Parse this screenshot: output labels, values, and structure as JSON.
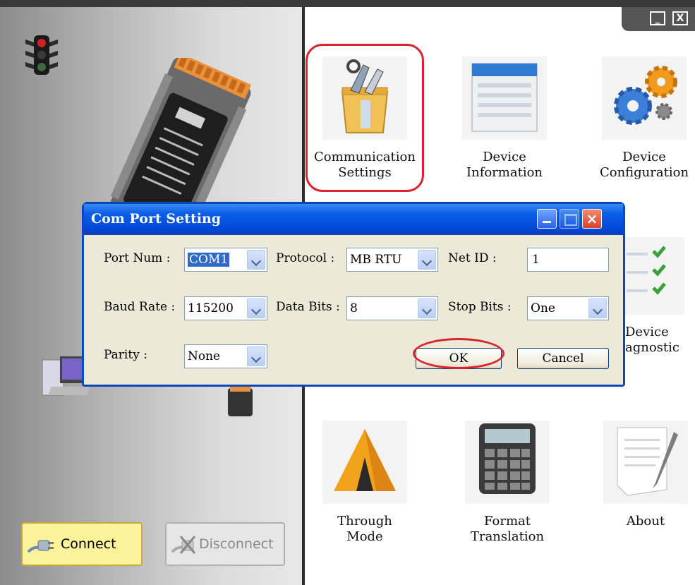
{
  "window": {
    "minimize_glyph": "_",
    "close_glyph": "X"
  },
  "left": {
    "connect_label": "Connect",
    "disconnect_label": "Disconnect"
  },
  "tiles": [
    {
      "label1": "Communication",
      "label2": "Settings",
      "icon": "toolbox-icon"
    },
    {
      "label1": "Device",
      "label2": "Information",
      "icon": "document-window-icon"
    },
    {
      "label1": "Device",
      "label2": "Configuration",
      "icon": "gears-icon"
    },
    {
      "label1": "Device",
      "label2": "Diagnostic",
      "icon": "checklist-icon"
    },
    {
      "label1": "Through",
      "label2": "Mode",
      "icon": "tent-icon"
    },
    {
      "label1": "Format",
      "label2": "Translation",
      "icon": "calculator-icon"
    },
    {
      "label1": "About",
      "label2": "",
      "icon": "notepad-icon"
    }
  ],
  "diag_visible": {
    "label1": "Device",
    "label2": "agnostic"
  },
  "dialog": {
    "title": "Com Port Setting",
    "close_glyph": "×",
    "fields": {
      "port_num": {
        "label": "Port Num :",
        "value": "COM1"
      },
      "protocol": {
        "label": "Protocol :",
        "value": "MB RTU"
      },
      "net_id": {
        "label": "Net ID :",
        "value": "1"
      },
      "baud_rate": {
        "label": "Baud Rate :",
        "value": "115200"
      },
      "data_bits": {
        "label": "Data Bits :",
        "value": "8"
      },
      "stop_bits": {
        "label": "Stop Bits :",
        "value": "One"
      },
      "parity": {
        "label": "Parity :",
        "value": "None"
      }
    },
    "ok_label": "OK",
    "cancel_label": "Cancel"
  },
  "colors": {
    "highlight": "#d9242e",
    "titlebar": "#0048d8",
    "connect_bg": "#fcf29a"
  }
}
